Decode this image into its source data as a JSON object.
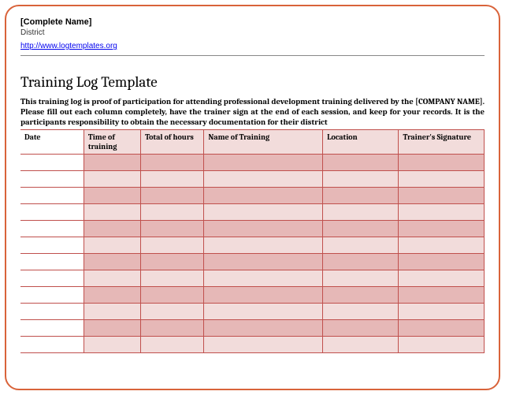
{
  "header": {
    "complete_name": "[Complete Name]",
    "district": "District",
    "link_text": "http://www.logtemplates.org"
  },
  "title": "Training Log Template",
  "intro": "This training log is proof of participation for attending professional development training delivered by the [COMPANY NAME]. Please fill out each column completely, have the trainer sign at the end of each session, and keep for your records. It is the participants responsibility to obtain the necessary documentation for their district",
  "columns": {
    "date": "Date",
    "time": "Time of training",
    "total": "Total of hours",
    "name": "Name of Training",
    "location": "Location",
    "signature": "Trainer's Signature"
  },
  "row_count": 12
}
